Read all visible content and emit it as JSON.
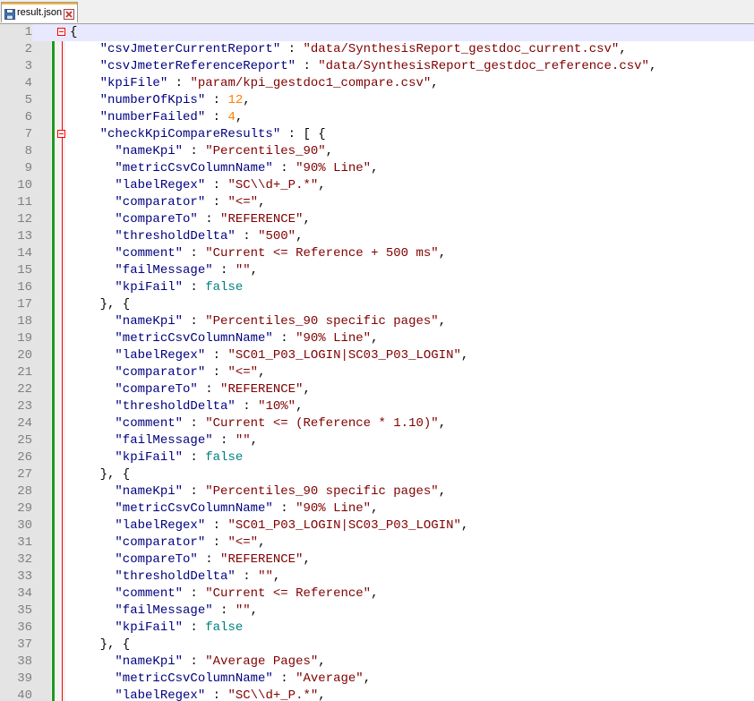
{
  "tab": {
    "filename": "result.json",
    "file_icon": "save-disk-icon",
    "close_icon": "close-icon"
  },
  "colors": {
    "key": "#000080",
    "string": "#800000",
    "number": "#ff8000",
    "boolean": "#008080",
    "change_bar": "#1f9b1f",
    "fold_marker": "#ff0000"
  },
  "lines": [
    {
      "n": "1",
      "fold": true,
      "tokens": [
        {
          "t": "p",
          "v": "{"
        }
      ]
    },
    {
      "n": "2",
      "tokens": [
        {
          "t": "k",
          "v": "    \"csvJmeterCurrentReport\""
        },
        {
          "t": "p",
          "v": " : "
        },
        {
          "t": "s",
          "v": "\"data/SynthesisReport_gestdoc_current.csv\""
        },
        {
          "t": "p",
          "v": ","
        }
      ]
    },
    {
      "n": "3",
      "tokens": [
        {
          "t": "k",
          "v": "    \"csvJmeterReferenceReport\""
        },
        {
          "t": "p",
          "v": " : "
        },
        {
          "t": "s",
          "v": "\"data/SynthesisReport_gestdoc_reference.csv\""
        },
        {
          "t": "p",
          "v": ","
        }
      ]
    },
    {
      "n": "4",
      "tokens": [
        {
          "t": "k",
          "v": "    \"kpiFile\""
        },
        {
          "t": "p",
          "v": " : "
        },
        {
          "t": "s",
          "v": "\"param/kpi_gestdoc1_compare.csv\""
        },
        {
          "t": "p",
          "v": ","
        }
      ]
    },
    {
      "n": "5",
      "tokens": [
        {
          "t": "k",
          "v": "    \"numberOfKpis\""
        },
        {
          "t": "p",
          "v": " : "
        },
        {
          "t": "n",
          "v": "12"
        },
        {
          "t": "p",
          "v": ","
        }
      ]
    },
    {
      "n": "6",
      "tokens": [
        {
          "t": "k",
          "v": "    \"numberFailed\""
        },
        {
          "t": "p",
          "v": " : "
        },
        {
          "t": "n",
          "v": "4"
        },
        {
          "t": "p",
          "v": ","
        }
      ]
    },
    {
      "n": "7",
      "fold": true,
      "tokens": [
        {
          "t": "k",
          "v": "    \"checkKpiCompareResults\""
        },
        {
          "t": "p",
          "v": " : [ {"
        }
      ]
    },
    {
      "n": "8",
      "tokens": [
        {
          "t": "k",
          "v": "      \"nameKpi\""
        },
        {
          "t": "p",
          "v": " : "
        },
        {
          "t": "s",
          "v": "\"Percentiles_90\""
        },
        {
          "t": "p",
          "v": ","
        }
      ]
    },
    {
      "n": "9",
      "tokens": [
        {
          "t": "k",
          "v": "      \"metricCsvColumnName\""
        },
        {
          "t": "p",
          "v": " : "
        },
        {
          "t": "s",
          "v": "\"90% Line\""
        },
        {
          "t": "p",
          "v": ","
        }
      ]
    },
    {
      "n": "10",
      "tokens": [
        {
          "t": "k",
          "v": "      \"labelRegex\""
        },
        {
          "t": "p",
          "v": " : "
        },
        {
          "t": "s",
          "v": "\"SC\\\\d+_P.*\""
        },
        {
          "t": "p",
          "v": ","
        }
      ]
    },
    {
      "n": "11",
      "tokens": [
        {
          "t": "k",
          "v": "      \"comparator\""
        },
        {
          "t": "p",
          "v": " : "
        },
        {
          "t": "s",
          "v": "\"<=\""
        },
        {
          "t": "p",
          "v": ","
        }
      ]
    },
    {
      "n": "12",
      "tokens": [
        {
          "t": "k",
          "v": "      \"compareTo\""
        },
        {
          "t": "p",
          "v": " : "
        },
        {
          "t": "s",
          "v": "\"REFERENCE\""
        },
        {
          "t": "p",
          "v": ","
        }
      ]
    },
    {
      "n": "13",
      "tokens": [
        {
          "t": "k",
          "v": "      \"thresholdDelta\""
        },
        {
          "t": "p",
          "v": " : "
        },
        {
          "t": "s",
          "v": "\"500\""
        },
        {
          "t": "p",
          "v": ","
        }
      ]
    },
    {
      "n": "14",
      "tokens": [
        {
          "t": "k",
          "v": "      \"comment\""
        },
        {
          "t": "p",
          "v": " : "
        },
        {
          "t": "s",
          "v": "\"Current <= Reference + 500 ms\""
        },
        {
          "t": "p",
          "v": ","
        }
      ]
    },
    {
      "n": "15",
      "tokens": [
        {
          "t": "k",
          "v": "      \"failMessage\""
        },
        {
          "t": "p",
          "v": " : "
        },
        {
          "t": "s",
          "v": "\"\""
        },
        {
          "t": "p",
          "v": ","
        }
      ]
    },
    {
      "n": "16",
      "tokens": [
        {
          "t": "k",
          "v": "      \"kpiFail\""
        },
        {
          "t": "p",
          "v": " : "
        },
        {
          "t": "b",
          "v": "false"
        }
      ]
    },
    {
      "n": "17",
      "tokens": [
        {
          "t": "p",
          "v": "    }, {"
        }
      ]
    },
    {
      "n": "18",
      "tokens": [
        {
          "t": "k",
          "v": "      \"nameKpi\""
        },
        {
          "t": "p",
          "v": " : "
        },
        {
          "t": "s",
          "v": "\"Percentiles_90 specific pages\""
        },
        {
          "t": "p",
          "v": ","
        }
      ]
    },
    {
      "n": "19",
      "tokens": [
        {
          "t": "k",
          "v": "      \"metricCsvColumnName\""
        },
        {
          "t": "p",
          "v": " : "
        },
        {
          "t": "s",
          "v": "\"90% Line\""
        },
        {
          "t": "p",
          "v": ","
        }
      ]
    },
    {
      "n": "20",
      "tokens": [
        {
          "t": "k",
          "v": "      \"labelRegex\""
        },
        {
          "t": "p",
          "v": " : "
        },
        {
          "t": "s",
          "v": "\"SC01_P03_LOGIN|SC03_P03_LOGIN\""
        },
        {
          "t": "p",
          "v": ","
        }
      ]
    },
    {
      "n": "21",
      "tokens": [
        {
          "t": "k",
          "v": "      \"comparator\""
        },
        {
          "t": "p",
          "v": " : "
        },
        {
          "t": "s",
          "v": "\"<=\""
        },
        {
          "t": "p",
          "v": ","
        }
      ]
    },
    {
      "n": "22",
      "tokens": [
        {
          "t": "k",
          "v": "      \"compareTo\""
        },
        {
          "t": "p",
          "v": " : "
        },
        {
          "t": "s",
          "v": "\"REFERENCE\""
        },
        {
          "t": "p",
          "v": ","
        }
      ]
    },
    {
      "n": "23",
      "tokens": [
        {
          "t": "k",
          "v": "      \"thresholdDelta\""
        },
        {
          "t": "p",
          "v": " : "
        },
        {
          "t": "s",
          "v": "\"10%\""
        },
        {
          "t": "p",
          "v": ","
        }
      ]
    },
    {
      "n": "24",
      "tokens": [
        {
          "t": "k",
          "v": "      \"comment\""
        },
        {
          "t": "p",
          "v": " : "
        },
        {
          "t": "s",
          "v": "\"Current <= (Reference * 1.10)\""
        },
        {
          "t": "p",
          "v": ","
        }
      ]
    },
    {
      "n": "25",
      "tokens": [
        {
          "t": "k",
          "v": "      \"failMessage\""
        },
        {
          "t": "p",
          "v": " : "
        },
        {
          "t": "s",
          "v": "\"\""
        },
        {
          "t": "p",
          "v": ","
        }
      ]
    },
    {
      "n": "26",
      "tokens": [
        {
          "t": "k",
          "v": "      \"kpiFail\""
        },
        {
          "t": "p",
          "v": " : "
        },
        {
          "t": "b",
          "v": "false"
        }
      ]
    },
    {
      "n": "27",
      "tokens": [
        {
          "t": "p",
          "v": "    }, {"
        }
      ]
    },
    {
      "n": "28",
      "tokens": [
        {
          "t": "k",
          "v": "      \"nameKpi\""
        },
        {
          "t": "p",
          "v": " : "
        },
        {
          "t": "s",
          "v": "\"Percentiles_90 specific pages\""
        },
        {
          "t": "p",
          "v": ","
        }
      ]
    },
    {
      "n": "29",
      "tokens": [
        {
          "t": "k",
          "v": "      \"metricCsvColumnName\""
        },
        {
          "t": "p",
          "v": " : "
        },
        {
          "t": "s",
          "v": "\"90% Line\""
        },
        {
          "t": "p",
          "v": ","
        }
      ]
    },
    {
      "n": "30",
      "tokens": [
        {
          "t": "k",
          "v": "      \"labelRegex\""
        },
        {
          "t": "p",
          "v": " : "
        },
        {
          "t": "s",
          "v": "\"SC01_P03_LOGIN|SC03_P03_LOGIN\""
        },
        {
          "t": "p",
          "v": ","
        }
      ]
    },
    {
      "n": "31",
      "tokens": [
        {
          "t": "k",
          "v": "      \"comparator\""
        },
        {
          "t": "p",
          "v": " : "
        },
        {
          "t": "s",
          "v": "\"<=\""
        },
        {
          "t": "p",
          "v": ","
        }
      ]
    },
    {
      "n": "32",
      "tokens": [
        {
          "t": "k",
          "v": "      \"compareTo\""
        },
        {
          "t": "p",
          "v": " : "
        },
        {
          "t": "s",
          "v": "\"REFERENCE\""
        },
        {
          "t": "p",
          "v": ","
        }
      ]
    },
    {
      "n": "33",
      "tokens": [
        {
          "t": "k",
          "v": "      \"thresholdDelta\""
        },
        {
          "t": "p",
          "v": " : "
        },
        {
          "t": "s",
          "v": "\"\""
        },
        {
          "t": "p",
          "v": ","
        }
      ]
    },
    {
      "n": "34",
      "tokens": [
        {
          "t": "k",
          "v": "      \"comment\""
        },
        {
          "t": "p",
          "v": " : "
        },
        {
          "t": "s",
          "v": "\"Current <= Reference\""
        },
        {
          "t": "p",
          "v": ","
        }
      ]
    },
    {
      "n": "35",
      "tokens": [
        {
          "t": "k",
          "v": "      \"failMessage\""
        },
        {
          "t": "p",
          "v": " : "
        },
        {
          "t": "s",
          "v": "\"\""
        },
        {
          "t": "p",
          "v": ","
        }
      ]
    },
    {
      "n": "36",
      "tokens": [
        {
          "t": "k",
          "v": "      \"kpiFail\""
        },
        {
          "t": "p",
          "v": " : "
        },
        {
          "t": "b",
          "v": "false"
        }
      ]
    },
    {
      "n": "37",
      "tokens": [
        {
          "t": "p",
          "v": "    }, {"
        }
      ]
    },
    {
      "n": "38",
      "tokens": [
        {
          "t": "k",
          "v": "      \"nameKpi\""
        },
        {
          "t": "p",
          "v": " : "
        },
        {
          "t": "s",
          "v": "\"Average Pages\""
        },
        {
          "t": "p",
          "v": ","
        }
      ]
    },
    {
      "n": "39",
      "tokens": [
        {
          "t": "k",
          "v": "      \"metricCsvColumnName\""
        },
        {
          "t": "p",
          "v": " : "
        },
        {
          "t": "s",
          "v": "\"Average\""
        },
        {
          "t": "p",
          "v": ","
        }
      ]
    },
    {
      "n": "40",
      "tokens": [
        {
          "t": "k",
          "v": "      \"labelRegex\""
        },
        {
          "t": "p",
          "v": " : "
        },
        {
          "t": "s",
          "v": "\"SC\\\\d+_P.*\""
        },
        {
          "t": "p",
          "v": ","
        }
      ]
    }
  ]
}
